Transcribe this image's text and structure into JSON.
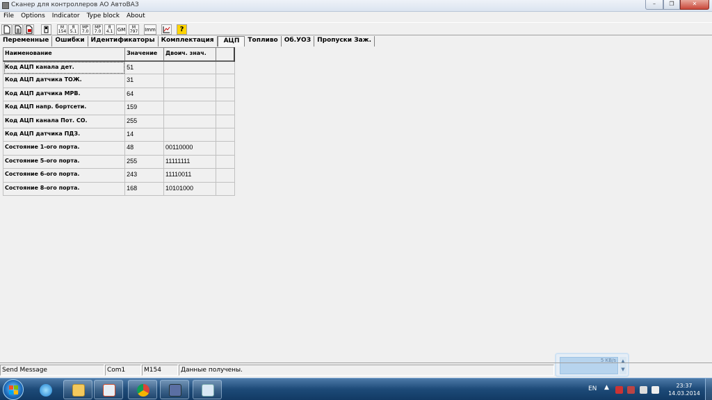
{
  "window": {
    "title": "Сканер для  контроллеров АО АвтоВАЗ"
  },
  "menu": [
    "File",
    "Options",
    "Indicator",
    "Type block",
    "About"
  ],
  "toolbar": {
    "buttons": [
      {
        "icon": "new-document-icon",
        "glyph": ""
      },
      {
        "icon": "open-document-icon",
        "glyph": ""
      },
      {
        "icon": "save-document-icon",
        "glyph": ""
      },
      {
        "icon": "device-icon",
        "glyph": ""
      },
      {
        "icon": "m154-icon",
        "glyph": "M\n154"
      },
      {
        "icon": "ya51-icon",
        "glyph": "Я\n5.1"
      },
      {
        "icon": "mp70-icon",
        "glyph": "MP\n7.0"
      },
      {
        "icon": "mp70b-icon",
        "glyph": "MP\n7.0"
      },
      {
        "icon": "ya41-icon",
        "glyph": "Я\n4.1"
      },
      {
        "icon": "gm-icon",
        "glyph": "GM"
      },
      {
        "icon": "m797-icon",
        "glyph": "M\n797"
      },
      {
        "icon": "imm-icon",
        "glyph": "Imm"
      },
      {
        "icon": "chart-icon",
        "glyph": ""
      },
      {
        "icon": "help-icon",
        "glyph": "?"
      }
    ]
  },
  "tabs": [
    {
      "label": "Переменные",
      "active": false
    },
    {
      "label": "Ошибки",
      "active": false
    },
    {
      "label": "Идентификаторы",
      "active": false
    },
    {
      "label": "Комплектация",
      "active": false
    },
    {
      "label": "АЦП",
      "active": true
    },
    {
      "label": "Топливо",
      "active": false
    },
    {
      "label": "Об.УОЗ",
      "active": false
    },
    {
      "label": "Пропуски Заж.",
      "active": false
    }
  ],
  "table": {
    "headers": [
      "Наименование",
      "Значение",
      "Двоич. знач.",
      ""
    ],
    "rows": [
      [
        "Код АЦП канала дет.",
        "51",
        "",
        ""
      ],
      [
        "Код АЦП датчика ТОЖ.",
        "31",
        "",
        ""
      ],
      [
        "Код АЦП датчика МРВ.",
        "64",
        "",
        ""
      ],
      [
        "Код АЦП напр. бортсети.",
        "159",
        "",
        ""
      ],
      [
        "Код АЦП канала Пот. СО.",
        "255",
        "",
        ""
      ],
      [
        "Код АЦП датчика ПДЗ.",
        "14",
        "",
        ""
      ],
      [
        "Состояние 1-ого порта.",
        "48",
        "00110000",
        ""
      ],
      [
        "Состояние 5-ого порта.",
        "255",
        "11111111",
        ""
      ],
      [
        "Состояние 6-ого порта.",
        "243",
        "11110011",
        ""
      ],
      [
        "Состояние 8-ого порта.",
        "168",
        "10101000",
        ""
      ]
    ]
  },
  "status": {
    "message": "Send Message",
    "port": "Com1",
    "block": "M154",
    "info": "Данные получены."
  },
  "net_widget": {
    "speed": "5 KB/s"
  },
  "taskbar": {
    "apps": [
      "explorer",
      "internet-explorer",
      "file-manager",
      "media-player",
      "chrome",
      "scanner-app",
      "paint"
    ],
    "lang": "EN",
    "time": "23:37",
    "date": "14.03.2014"
  }
}
